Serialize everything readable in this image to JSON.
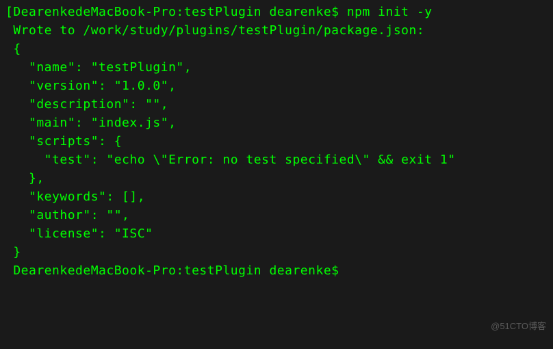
{
  "lines": {
    "l0": "[DearenkedeMacBook-Pro:testPlugin dearenke$ npm init -y",
    "l1": " Wrote to /work/study/plugins/testPlugin/package.json:",
    "l2": "",
    "l3": " {",
    "l4": "   \"name\": \"testPlugin\",",
    "l5": "   \"version\": \"1.0.0\",",
    "l6": "   \"description\": \"\",",
    "l7": "   \"main\": \"index.js\",",
    "l8": "   \"scripts\": {",
    "l9": "     \"test\": \"echo \\\"Error: no test specified\\\" && exit 1\"",
    "l10": "   },",
    "l11": "   \"keywords\": [],",
    "l12": "   \"author\": \"\",",
    "l13": "   \"license\": \"ISC\"",
    "l14": " }",
    "l15": "",
    "l16": "",
    "l17": " DearenkedeMacBook-Pro:testPlugin dearenke$"
  },
  "watermark": "@51CTO博客",
  "package_json": {
    "name": "testPlugin",
    "version": "1.0.0",
    "description": "",
    "main": "index.js",
    "scripts": {
      "test": "echo \"Error: no test specified\" && exit 1"
    },
    "keywords": [],
    "author": "",
    "license": "ISC"
  },
  "terminal": {
    "host": "DearenkedeMacBook-Pro",
    "directory": "testPlugin",
    "user": "dearenke",
    "command": "npm init -y",
    "output_path": "/work/study/plugins/testPlugin/package.json"
  }
}
